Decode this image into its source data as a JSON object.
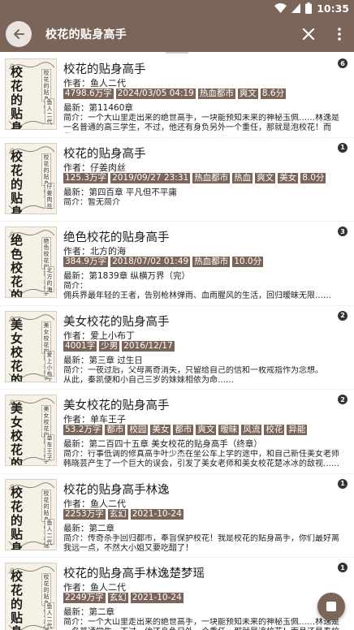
{
  "status": {
    "time": "10:35"
  },
  "search": {
    "query": "校花的贴身高手"
  },
  "books": [
    {
      "cover_title": "校花的贴身",
      "cover_sub": "校花的贴身高手",
      "cover_author": "鱼人二代",
      "title": "校花的贴身高手",
      "author": "作者：鱼人二代",
      "tags": [
        "4798.6万字",
        "2024/03/05 04:19",
        "热血都市",
        "爽文",
        "8.6分"
      ],
      "latest": "最新：第11460章",
      "intro": "简介：一个大山里走出来的绝世高手，一块能预知未来的神秘玉佩……林逸是一名普通的高三学生，不过，他还有身负另外一个重任，那就是泡校花！而且……",
      "badge": "6"
    },
    {
      "cover_title": "校花的贴身",
      "cover_sub": "校花的贴身高手",
      "cover_author": "仔姜肉丝",
      "title": "校花的贴身高手",
      "author": "作者：仔姜肉丝",
      "tags": [
        "125.3万字",
        "2019/09/27 23:31",
        "热血都市",
        "热血",
        "爽文",
        "美女",
        "8.0分"
      ],
      "latest": "最新：第四百章 平凡但不平庸",
      "intro": "简介：暂无简介",
      "badge": "1"
    },
    {
      "cover_title": "绝色校花的",
      "cover_sub": "绝色校花的贴身高手",
      "cover_author": "北方的海",
      "title": "绝色校花的贴身高手",
      "author": "作者：北方的海",
      "tags": [
        "384.9万字",
        "2018/07/02 01:49",
        "热血都市",
        "10.0分"
      ],
      "latest": "最新：第1839章 纵横万界（完）",
      "intro": "简介：\n    佣兵界最年轻的王者，告别枪林弹雨、血雨腥风的生活，回归暧昧无限……",
      "badge": "3"
    },
    {
      "cover_title": "美女校花的",
      "cover_sub": "美女校花的贴身高手",
      "cover_author": "爱上小布丁",
      "title": "美女校花的贴身高手",
      "author": "作者：爱上小布丁",
      "tags": [
        "4001字",
        "少男",
        "2016/12/17"
      ],
      "latest": "最新：第三章 过生日",
      "intro": "简介：一夜过后，父母离奇消失，只留给自己的信和一枚戒指作为念想。\n    从此，秦凯便和小自己三岁的妹妹相依为命……",
      "badge": "2"
    },
    {
      "cover_title": "美女校花的",
      "cover_sub": "美女校花的贴身高手",
      "cover_author": "单车王子",
      "title": "美女校花的贴身高手",
      "author": "作者：单车王子",
      "tags": [
        "53.2万字",
        "都市",
        "校园",
        "美女",
        "都市",
        "爽文",
        "暧昧",
        "风流",
        "校花",
        "异能"
      ],
      "latest": "最新：第二百四十五章 美女校花的贴身高手（终章）",
      "intro": "简介：行事低调的修真高手叶少杰在坐公车上学的途中，和自己新任美女老师韩晓芸产生了一个巨大的误会，引发了美女老师和美女校花楚冰冰的敌视……",
      "badge": "2"
    },
    {
      "cover_title": "校花的贴身",
      "cover_sub": "校花的贴身高手林逸",
      "cover_author": "鱼人二代",
      "title": "校花的贴身高手林逸",
      "author": "作者：鱼人二代",
      "tags": [
        "2253万字",
        "玄幻",
        "2021-10-24"
      ],
      "latest": "最新：第二章",
      "intro": "简介：传奇杀手回归都市，奉旨保护校花！我是校花的贴身高手，你们最好离我远一点，不然大小姐又要吃醋了！",
      "badge": "1"
    },
    {
      "cover_title": "校花的贴身",
      "cover_sub": "校花的贴身高手林逸楚梦瑶",
      "cover_author": "鱼人二代",
      "title": "校花的贴身高手林逸楚梦瑶",
      "author": "作者：鱼人二代",
      "tags": [
        "2249万字",
        "玄幻",
        "2021-10-24"
      ],
      "latest": "最新：第二章",
      "intro": "简介：一个大山里走出来的绝世高手，一块能预知未来的神秘玉佩……林逸是一名普通学生，不过，他还身负另外一个重任，那就是追校花！而且还是奉校花老爸之命！虽然林逸很不想跟这位难伺候的大小姐打交道，但是长辈之命难……",
      "badge": "1"
    }
  ]
}
